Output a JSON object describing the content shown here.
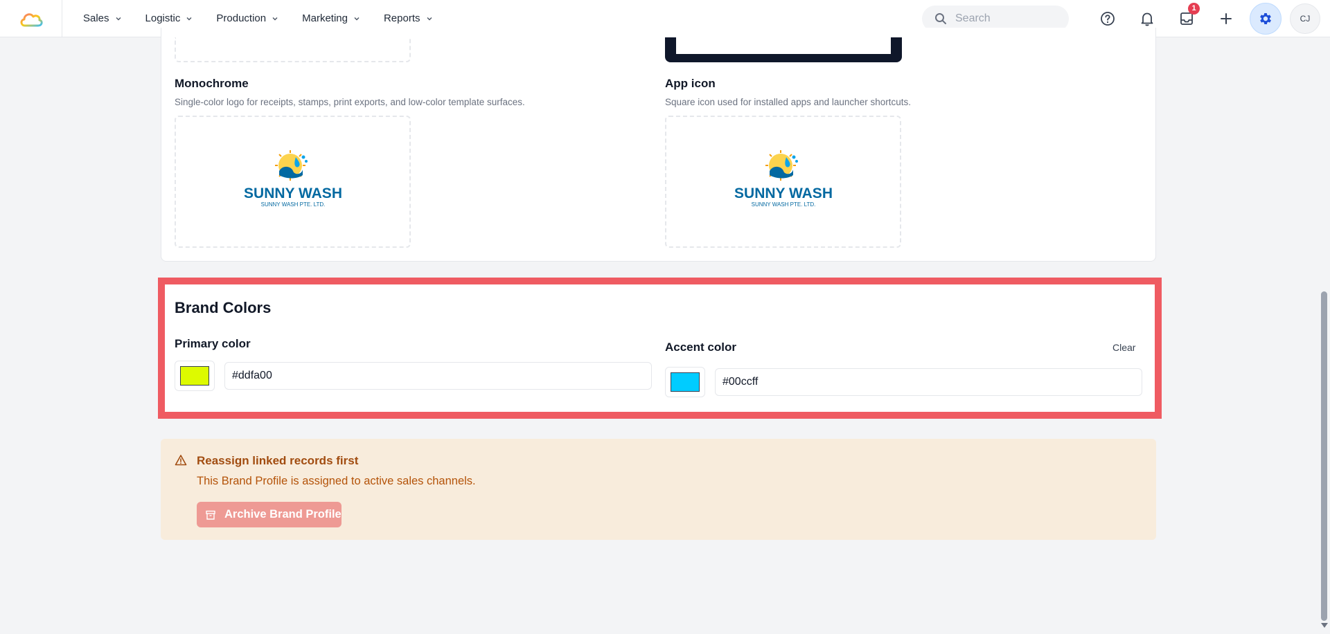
{
  "nav": {
    "items": [
      {
        "label": "Sales"
      },
      {
        "label": "Logistic"
      },
      {
        "label": "Production"
      },
      {
        "label": "Marketing"
      },
      {
        "label": "Reports"
      }
    ],
    "search_placeholder": "Search",
    "inbox_badge": "1",
    "avatar_initials": "CJ"
  },
  "logos": {
    "monochrome": {
      "title": "Monochrome",
      "description": "Single-color logo for receipts, stamps, print exports, and low-color template surfaces."
    },
    "app_icon": {
      "title": "App icon",
      "description": "Square icon used for installed apps and launcher shortcuts."
    },
    "logo_text": "SUNNY WASH",
    "logo_subtext": "SUNNY WASH PTE. LTD."
  },
  "brand_colors": {
    "title": "Brand Colors",
    "primary": {
      "label": "Primary color",
      "value": "#ddfa00",
      "swatch": "#ddfa00"
    },
    "accent": {
      "label": "Accent color",
      "value": "#00ccff",
      "swatch": "#00ccff",
      "clear_label": "Clear"
    }
  },
  "warning": {
    "title": "Reassign linked records first",
    "text": "This Brand Profile is assigned to active sales channels.",
    "button_label": "Archive Brand Profile"
  },
  "colors": {
    "highlight": "#ef5b62",
    "warning_bg": "#f8ecdc",
    "warning_text": "#b45309",
    "archive_button": "#ee9a94"
  }
}
